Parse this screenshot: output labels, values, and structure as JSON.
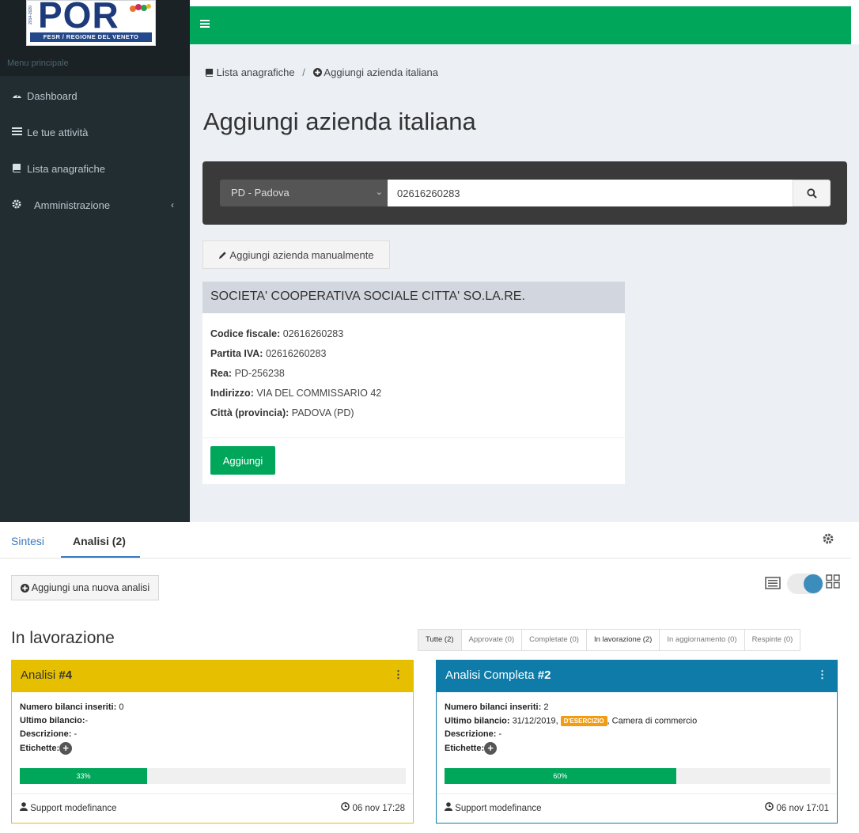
{
  "logo": {
    "text": "POR",
    "small_text": "2014-2020",
    "subtitle": "FESR / REGIONE DEL VENETO"
  },
  "sidebar": {
    "menu_header": "Menu principale",
    "items": [
      {
        "label": "Dashboard",
        "icon": "dashboard-icon"
      },
      {
        "label": "Le tue attività",
        "icon": "list-icon"
      },
      {
        "label": "Lista anagrafiche",
        "icon": "book-icon"
      },
      {
        "label": "Amministrazione",
        "icon": "gear-icon"
      }
    ]
  },
  "topbar": {
    "color": "#00a65a"
  },
  "breadcrumb": {
    "items": [
      "Lista anagrafiche",
      "Aggiungi azienda italiana"
    ],
    "separator": "/"
  },
  "page": {
    "title": "Aggiungi azienda italiana"
  },
  "search": {
    "province": "PD - Padova",
    "query": "02616260283"
  },
  "manual_button": "Aggiungi azienda manualmente",
  "company": {
    "name": "SOCIETA' COOPERATIVA SOCIALE CITTA' SO.LA.RE.",
    "fields": [
      {
        "label": "Codice fiscale:",
        "value": "02616260283"
      },
      {
        "label": "Partita IVA:",
        "value": "02616260283"
      },
      {
        "label": "Rea:",
        "value": "PD-256238"
      },
      {
        "label": "Indirizzo:",
        "value": "VIA DEL COMMISSARIO 42"
      },
      {
        "label": "Città (provincia):",
        "value": "PADOVA (PD)"
      }
    ],
    "add_button": "Aggiungi"
  },
  "tabs": [
    {
      "label": "Sintesi",
      "active": false
    },
    {
      "label": "Analisi (2)",
      "active": true
    }
  ],
  "new_analysis_button": "Aggiungi una nuova analisi",
  "section": {
    "title": "In lavorazione"
  },
  "filters": [
    "Tutte (2)",
    "Approvate (0)",
    "Completate (0)",
    "In lavorazione (2)",
    "In aggiornamento (0)",
    "Respinte (0)"
  ],
  "analyses": [
    {
      "title": "Analisi",
      "number": "#4",
      "header_color": "#e6c000",
      "label_balances": "Numero bilanci inseriti:",
      "balances": "0",
      "label_last": "Ultimo bilancio:",
      "last": "-",
      "label_description": "Descrizione:",
      "description": "-",
      "label_tags": "Etichette:",
      "progress": 33,
      "progress_label": "33%",
      "author": "Support modefinance",
      "date": "06 nov 17:28"
    },
    {
      "title": "Analisi Completa",
      "number": "#2",
      "header_color": "#0e7ba8",
      "label_balances": "Numero bilanci inseriti:",
      "balances": "2",
      "label_last": "Ultimo bilancio:",
      "last": "31/12/2019,",
      "badge": "D'ESERCIZIO",
      "last_source": ", Camera di commercio",
      "label_description": "Descrizione:",
      "description": "-",
      "label_tags": "Etichette:",
      "progress": 60,
      "progress_label": "60%",
      "author": "Support modefinance",
      "date": "06 nov 17:01"
    }
  ]
}
